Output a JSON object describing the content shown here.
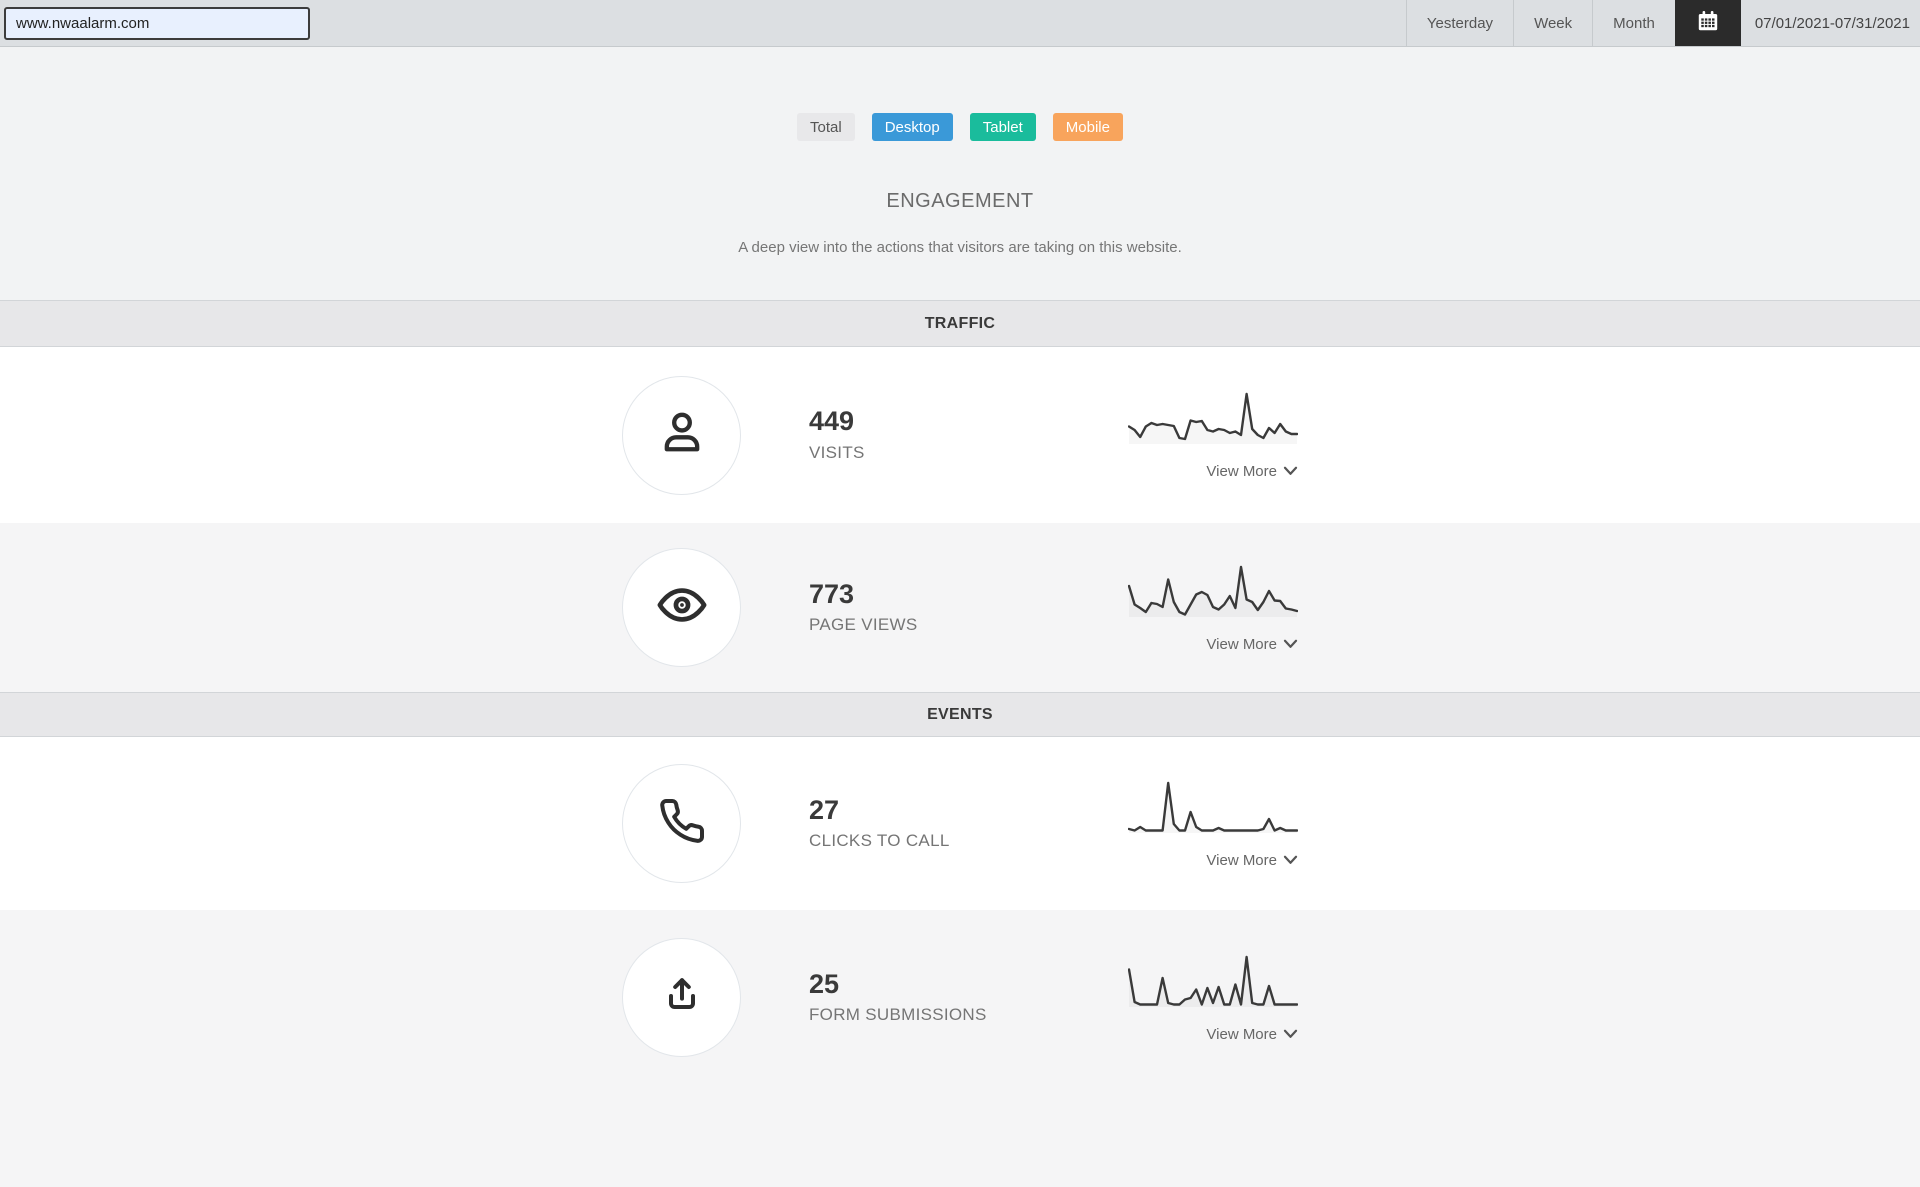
{
  "topbar": {
    "url_value": "www.nwaalarm.com",
    "tabs": [
      {
        "label": "Yesterday"
      },
      {
        "label": "Week"
      },
      {
        "label": "Month"
      }
    ],
    "calendar_icon": "calendar-icon",
    "calendar_bg": "#2b2b2b",
    "date_range": "07/01/2021-07/31/2021"
  },
  "filters": [
    {
      "label": "Total",
      "bg": "#e8e8ea",
      "color": "#555555"
    },
    {
      "label": "Desktop",
      "bg": "#3a99d8",
      "color": "#ffffff"
    },
    {
      "label": "Tablet",
      "bg": "#1abc9c",
      "color": "#ffffff"
    },
    {
      "label": "Mobile",
      "bg": "#f8a45c",
      "color": "#ffffff"
    }
  ],
  "engagement": {
    "title": "ENGAGEMENT",
    "subtitle": "A deep view into the actions that visitors are taking on this website."
  },
  "sections": [
    {
      "header": "TRAFFIC",
      "metrics": [
        {
          "icon": "user-icon",
          "value": "449",
          "label": "VISITS",
          "view_more": "View More",
          "spark": [
            35,
            28,
            14,
            35,
            42,
            38,
            40,
            38,
            36,
            12,
            10,
            47,
            44,
            46,
            28,
            25,
            30,
            28,
            22,
            25,
            18,
            100,
            30,
            18,
            12,
            32,
            22,
            40,
            25,
            20,
            20
          ]
        },
        {
          "icon": "eye-icon",
          "value": "773",
          "label": "PAGE VIEWS",
          "view_more": "View More",
          "spark": [
            62,
            25,
            18,
            10,
            28,
            26,
            20,
            75,
            30,
            10,
            5,
            25,
            45,
            50,
            44,
            20,
            15,
            25,
            42,
            18,
            100,
            35,
            30,
            14,
            30,
            52,
            33,
            32,
            17,
            15,
            12
          ]
        }
      ]
    },
    {
      "header": "EVENTS",
      "metrics": [
        {
          "icon": "phone-icon",
          "value": "27",
          "label": "CLICKS TO CALL",
          "view_more": "View More",
          "spark": [
            8,
            5,
            12,
            5,
            5,
            5,
            5,
            100,
            18,
            5,
            5,
            42,
            12,
            5,
            5,
            5,
            10,
            5,
            5,
            5,
            5,
            5,
            5,
            5,
            8,
            28,
            5,
            10,
            5,
            5,
            5
          ]
        },
        {
          "icon": "upload-icon",
          "value": "25",
          "label": "FORM SUBMISSIONS",
          "view_more": "View More",
          "spark": [
            75,
            10,
            5,
            5,
            5,
            5,
            58,
            8,
            5,
            5,
            15,
            18,
            35,
            5,
            38,
            8,
            40,
            5,
            5,
            45,
            5,
            100,
            8,
            5,
            5,
            42,
            5,
            5,
            5,
            5,
            5
          ]
        }
      ]
    }
  ],
  "spark_style": {
    "line_color": "#3a3a3a",
    "fill_color": "rgba(0,0,0,0.035)"
  }
}
